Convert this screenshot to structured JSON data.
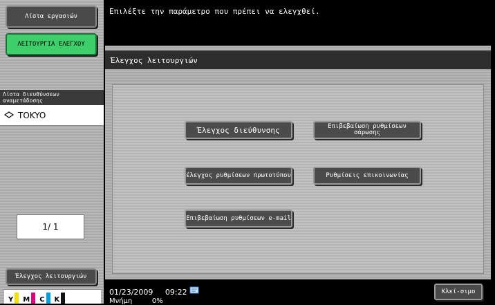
{
  "left_panel": {
    "job_list_label": "Λίστα εργασιών",
    "utility_label": "ΛΕΙΤΟΥΡΓΙΑ ΕΛΕΓΧΟΥ",
    "dest_list_title": "Λίστα διευθύνσεων αναμετάδοσης",
    "dest_item": "TOKYO",
    "pager": "1/ 1",
    "check_label": "Έλεγχος λειτουργιών",
    "toner": [
      {
        "letter": "Y",
        "color": "#f2e100"
      },
      {
        "letter": "M",
        "color": "#e0007a"
      },
      {
        "letter": "C",
        "color": "#00a0e0"
      },
      {
        "letter": "K",
        "color": "#111111"
      }
    ]
  },
  "header": {
    "message": "Επιλέξτε την παράμετρο που πρέπει να ελεγχθεί."
  },
  "main": {
    "title": "Έλεγχος λειτουργιών",
    "buttons": {
      "address_check": "Έλεγχος διεύθυνσης",
      "scan_settings": "Επιβεβαίωση ρυθμίσεων σάρωσης",
      "original_settings": "έλεγχος ρυθμίσεων πρωτοτύπου",
      "comm_settings": "Ρυθμίσεις επικοινωνίας",
      "email_settings": "Επιβεβαίωση ρυθμίσεων e-mail"
    }
  },
  "status": {
    "date": "01/23/2009",
    "time": "09:22",
    "memory_label": "Μνήμη",
    "memory_value": "0%",
    "close_label": "Κλεί-σιμο"
  }
}
